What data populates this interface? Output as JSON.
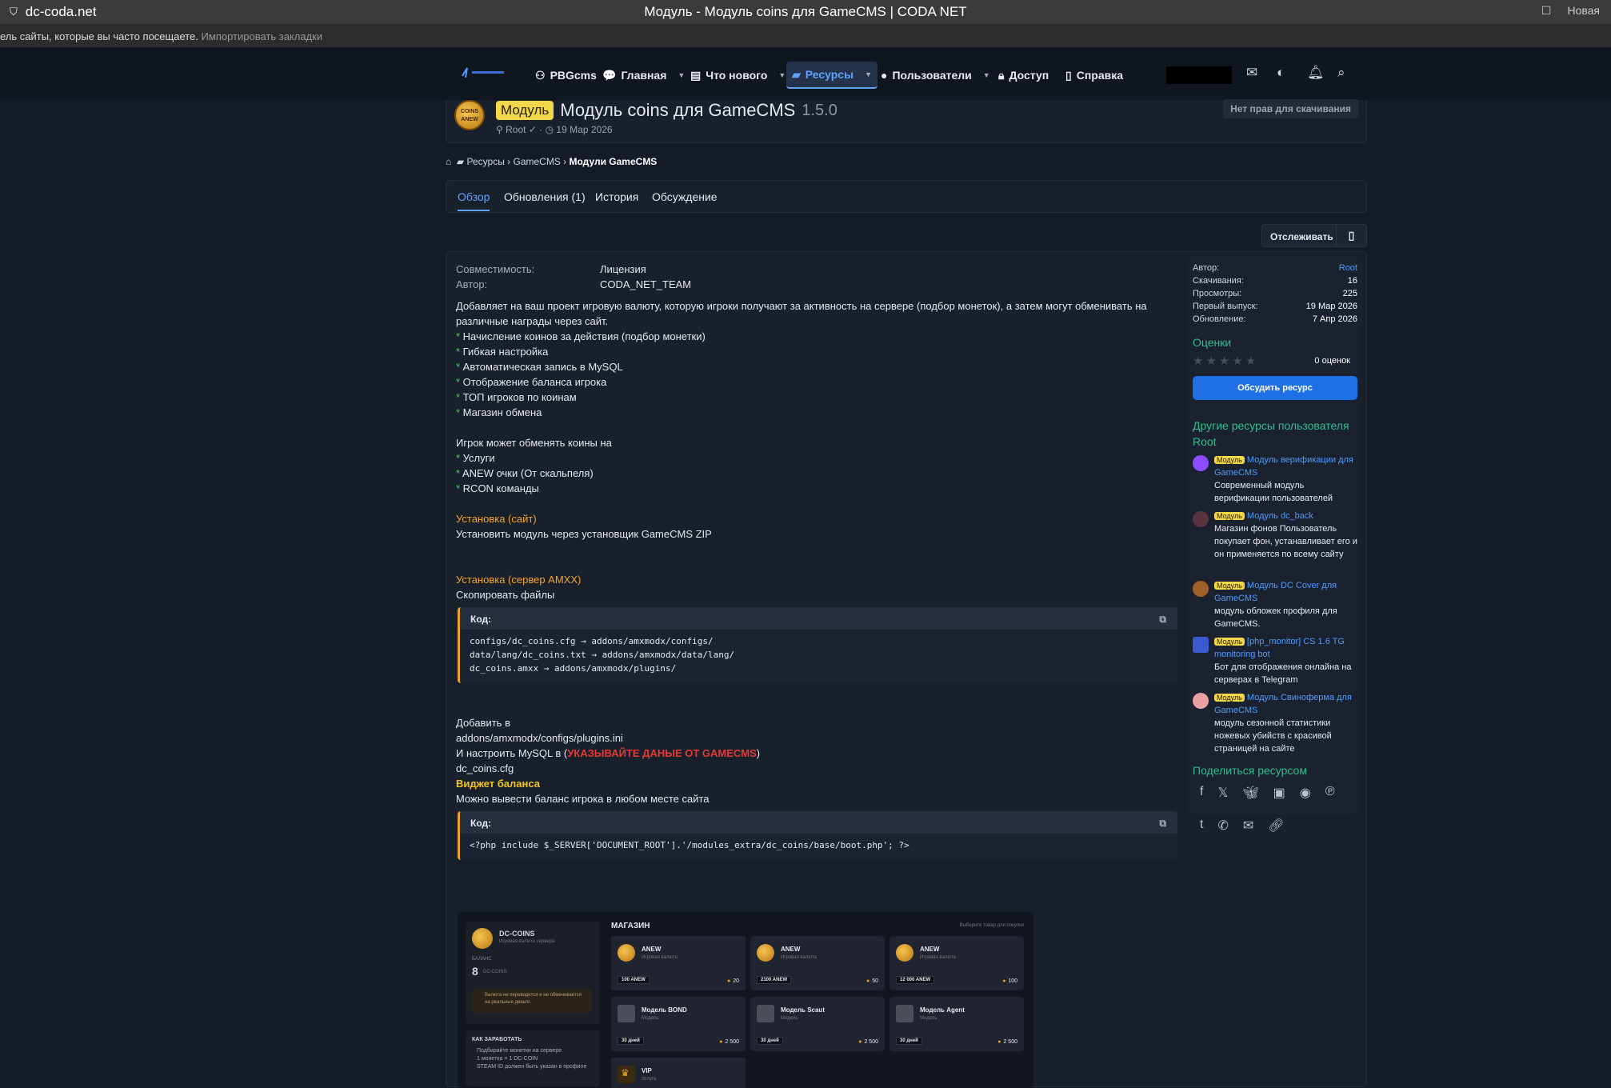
{
  "browser": {
    "url": "dc-coda.net",
    "window_title": "Модуль - Модуль coins для GameCMS | CODA NET",
    "right_text": "Новая"
  },
  "bookmarks": {
    "text": "ель сайты, которые вы часто посещаете.",
    "import_link": "Импортировать закладки"
  },
  "nav": {
    "items": [
      {
        "label": "PBGcms",
        "icon": "gamepad-icon"
      },
      {
        "label": "Главная",
        "icon": "chat-icon"
      },
      {
        "label": "Что нового",
        "icon": "news-icon"
      },
      {
        "label": "Ресурсы",
        "icon": "folder-icon"
      },
      {
        "label": "Пользователи",
        "icon": "user-icon"
      },
      {
        "label": "Доступ",
        "icon": "lock-icon"
      },
      {
        "label": "Справка",
        "icon": "file-icon"
      }
    ],
    "active": "Ресурсы"
  },
  "resource": {
    "avatar_text": "COINS ANEW",
    "badge": "Модуль",
    "title": "Модуль coins для GameCMS",
    "version": "1.5.0",
    "author": "Root",
    "date": "19 Мар 2026",
    "no_download": "Нет прав для скачивания"
  },
  "breadcrumb": {
    "items": [
      "Ресурсы",
      "GameCMS"
    ],
    "current": "Модули GameCMS"
  },
  "tabs": [
    "Обзор",
    "Обновления (1)",
    "История",
    "Обсуждение"
  ],
  "watch": {
    "label": "Отслеживать"
  },
  "fields": [
    {
      "key": "Совместимость:",
      "value": "Лицензия"
    },
    {
      "key": "Автор:",
      "value": "CODA_NET_TEAM"
    }
  ],
  "description": {
    "intro": "Добавляет на ваш проект игровую валюту, которую игроки получают за активность на сервере (подбор монеток), а затем могут обменивать на различные награды через сайт.",
    "features": [
      "Начисление коинов за действия (подбор монетки)",
      "Гибкая настройка",
      "Автоматическая запись в MySQL",
      "Отображение баланса игрока",
      "ТОП игроков по коинам",
      "Магазин обмена"
    ],
    "exchange_title": "Игрок может обменять коины на",
    "exchange_items": [
      "Услуги",
      "ANEW очки (От скальпеля)",
      "RCON команды"
    ],
    "install_site_title": "Установка (сайт)",
    "install_site_text": "Установить модуль через установщик GameCMS ZIP",
    "install_server_title": "Установка (сервер AMXX)",
    "install_server_text": "Скопировать файлы",
    "code_label": "Код:",
    "code1": "configs/dc_coins.cfg → addons/amxmodx/configs/\ndata/lang/dc_coins.txt → addons/amxmodx/data/lang/\ndc_coins.amxx → addons/amxmodx/plugins/",
    "add_in": "Добавить в",
    "plugins_path": "addons/amxmodx/configs/plugins.ini",
    "mysql_prefix": "И настроить MySQL в (",
    "mysql_red": "УКАЗЫВАЙТЕ ДАНЫЕ ОТ GAMECMS",
    "mysql_suffix": ")",
    "cfg_file": "dc_coins.cfg",
    "widget_title": "Виджет баланса",
    "widget_text": "Можно вывести баланс игрока в любом месте сайта",
    "code2": "<?php include $_SERVER['DOCUMENT_ROOT'].'/modules_extra/dc_coins/base/boot.php'; ?>"
  },
  "shop_preview": {
    "brand": "DC-COINS",
    "brand_sub": "Игровая валюта сервера",
    "balance_label": "БАЛАНС",
    "balance_value": "8",
    "balance_unit": "DC-COINS",
    "note": "Валюта не переводится и не обменивается на реальные деньги.",
    "how_title": "КАК ЗАРАБОТАТЬ",
    "how_lines": [
      "Подбирайте монетки на сервере",
      "1 монетка = 1 DC-COIN",
      "STEAM ID должен быть указан в профиле"
    ],
    "shop_title": "МАГАЗИН",
    "shop_hint": "Выберите товар для покупки",
    "items": [
      {
        "name": "ANEW",
        "sub": "Игровая валюта",
        "tag": "100 ANEW",
        "price": "20",
        "kind": "coin"
      },
      {
        "name": "ANEW",
        "sub": "Игровая валюта",
        "tag": "2100 ANEW",
        "price": "50",
        "kind": "coin"
      },
      {
        "name": "ANEW",
        "sub": "Игровая валюта",
        "tag": "12 000 ANEW",
        "price": "100",
        "kind": "coin"
      },
      {
        "name": "Модель BOND",
        "sub": "Модель",
        "tag": "30 дней",
        "price": "2 500",
        "kind": "person"
      },
      {
        "name": "Модель Scaut",
        "sub": "Модель",
        "tag": "30 дней",
        "price": "2 500",
        "kind": "person"
      },
      {
        "name": "Модель Agent",
        "sub": "Модель",
        "tag": "30 дней",
        "price": "2 500",
        "kind": "person"
      },
      {
        "name": "VIP",
        "sub": "Услуга",
        "tag": "",
        "price": "",
        "kind": "vip"
      }
    ]
  },
  "sidebar": {
    "stats": [
      {
        "key": "Автор:",
        "value": "Root"
      },
      {
        "key": "Скачивания:",
        "value": "16"
      },
      {
        "key": "Просмотры:",
        "value": "225"
      },
      {
        "key": "Первый выпуск:",
        "value": "19 Мар 2026"
      },
      {
        "key": "Обновление:",
        "value": "7 Апр 2026"
      }
    ],
    "ratings_title": "Оценки",
    "rating_stars": 0,
    "rating_count": "0 оценок",
    "discuss_label": "Обсудить ресурс",
    "other_title": "Другие ресурсы пользователя Root",
    "other": [
      {
        "badge": "Модуль",
        "title": "Модуль верификации для GameCMS",
        "desc": "Современный модуль верификации пользователей",
        "avatar": "#8b4dff"
      },
      {
        "badge": "Модуль",
        "title": "Модуль dc_back",
        "desc": "Магазин фонов Пользователь покупает фон, устанавливает его и он применяется по всему сайту",
        "avatar": "#5a3440"
      },
      {
        "badge": "Модуль",
        "title": "Модуль DC Cover для GameCMS",
        "desc": "модуль обложек профиля для GameCMS.",
        "avatar": "#a0602a"
      },
      {
        "badge": "Модуль",
        "title": "[php_monitor] CS 1.6 TG monitoring bot",
        "desc": "Бот для отображения онлайна на серверах в Telegram",
        "avatar": "#3a5bd0"
      },
      {
        "badge": "Модуль",
        "title": "Модуль Свиноферма для GameCMS",
        "desc": "модуль сезонной статистики ножевых убийств с красивой страницей на сайте",
        "avatar": "#e8a0a0"
      }
    ],
    "share_title": "Поделиться ресурсом",
    "share_icons": [
      "facebook-icon",
      "x-icon",
      "bluesky-icon",
      "linkedin-icon",
      "reddit-icon",
      "pinterest-icon",
      "tumblr-icon",
      "whatsapp-icon",
      "email-icon",
      "link-icon"
    ]
  }
}
